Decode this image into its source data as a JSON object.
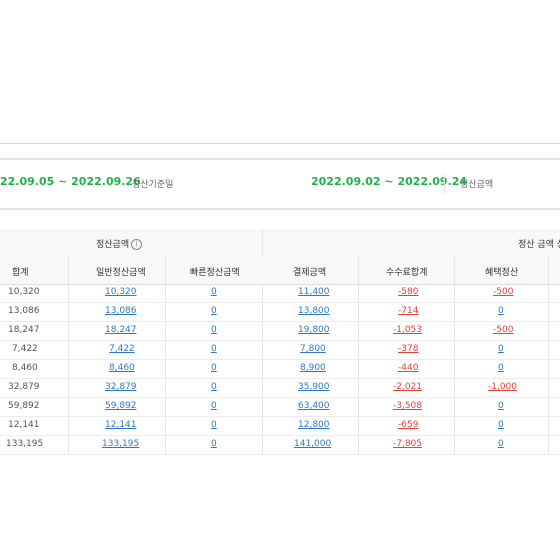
{
  "summary": {
    "left_range": "22.09.05 ~ 2022.09.26",
    "left_caption": "정산기준일",
    "right_range": "2022.09.02 ~ 2022.09.24",
    "right_caption": "정산금액"
  },
  "table": {
    "group_header_amount": "정산금액",
    "group_header_detail": "정산 금액 상",
    "columns": {
      "total": "합계",
      "normal": "일반정산금액",
      "fast": "빠른정산금액",
      "payment": "결제금액",
      "fee": "수수료합계",
      "benefit": "혜택정산"
    },
    "rows": [
      {
        "total": "10,320",
        "normal": "10,320",
        "fast": "0",
        "payment": "11,400",
        "fee": "-580",
        "benefit": "-500"
      },
      {
        "total": "13,086",
        "normal": "13,086",
        "fast": "0",
        "payment": "13,800",
        "fee": "-714",
        "benefit": "0"
      },
      {
        "total": "18,247",
        "normal": "18,247",
        "fast": "0",
        "payment": "19,800",
        "fee": "-1,053",
        "benefit": "-500"
      },
      {
        "total": "7,422",
        "normal": "7,422",
        "fast": "0",
        "payment": "7,800",
        "fee": "-378",
        "benefit": "0"
      },
      {
        "total": "8,460",
        "normal": "8,460",
        "fast": "0",
        "payment": "8,900",
        "fee": "-440",
        "benefit": "0"
      },
      {
        "total": "32,879",
        "normal": "32,879",
        "fast": "0",
        "payment": "35,900",
        "fee": "-2,021",
        "benefit": "-1,000"
      },
      {
        "total": "59,892",
        "normal": "59,892",
        "fast": "0",
        "payment": "63,400",
        "fee": "-3,508",
        "benefit": "0"
      },
      {
        "total": "12,141",
        "normal": "12,141",
        "fast": "0",
        "payment": "12,800",
        "fee": "-659",
        "benefit": "0"
      },
      {
        "total": "133,195",
        "normal": "133,195",
        "fast": "0",
        "payment": "141,000",
        "fee": "-7,805",
        "benefit": "0"
      }
    ]
  },
  "colors": {
    "range_green": "#1fb24c",
    "link_blue": "#2f78c8",
    "negative_red": "#e2433b",
    "header_bg": "#f7f8fa"
  }
}
